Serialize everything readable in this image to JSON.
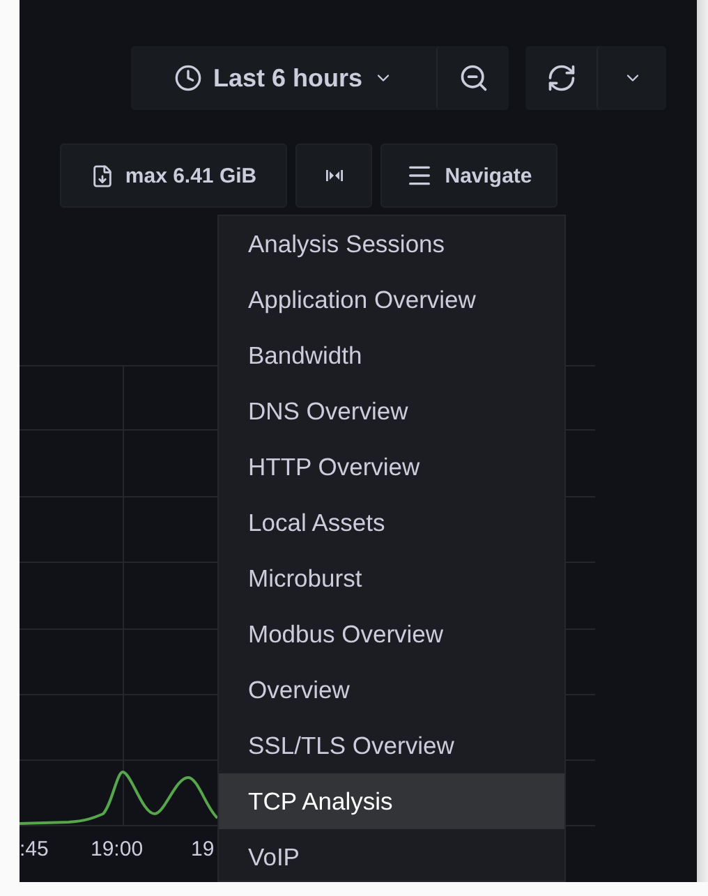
{
  "time_picker": {
    "label": "Last 6 hours"
  },
  "toolbar": {
    "max_label": "max 6.41 GiB",
    "navigate_label": "Navigate"
  },
  "chart": {
    "x_labels": [
      ":45",
      "19:00",
      "19"
    ]
  },
  "menu": {
    "items": [
      {
        "label": "Analysis Sessions",
        "selected": false
      },
      {
        "label": "Application Overview",
        "selected": false
      },
      {
        "label": "Bandwidth",
        "selected": false
      },
      {
        "label": "DNS Overview",
        "selected": false
      },
      {
        "label": "HTTP Overview",
        "selected": false
      },
      {
        "label": "Local Assets",
        "selected": false
      },
      {
        "label": "Microburst",
        "selected": false
      },
      {
        "label": "Modbus Overview",
        "selected": false
      },
      {
        "label": "Overview",
        "selected": false
      },
      {
        "label": "SSL/TLS Overview",
        "selected": false
      },
      {
        "label": "TCP Analysis",
        "selected": true
      },
      {
        "label": "VoIP",
        "selected": false
      }
    ]
  }
}
